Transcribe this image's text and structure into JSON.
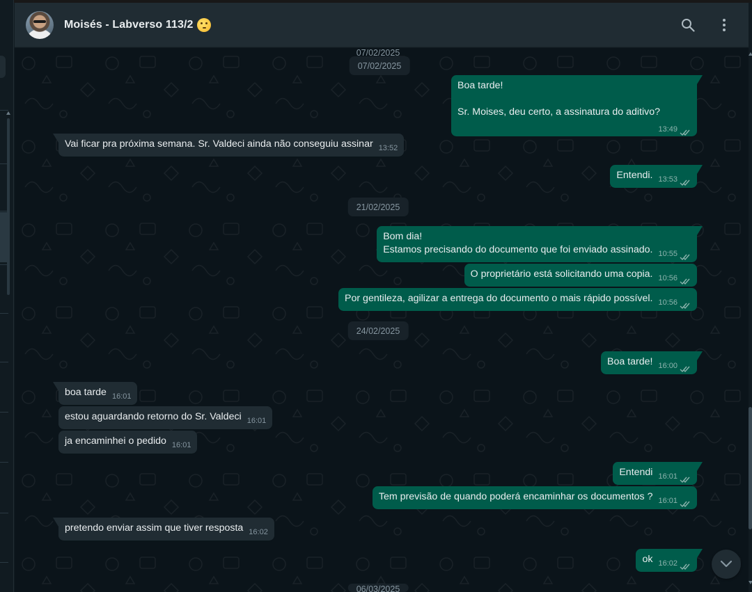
{
  "header": {
    "contact_name": "Moisés - Labverso 113/2",
    "avatar": "contact-photo",
    "emoji": "shushing-face-emoji",
    "actions": [
      "search-icon",
      "menu-dots-icon"
    ]
  },
  "colors": {
    "outgoing_bubble": "#005c4b",
    "incoming_bubble": "#202c33",
    "chat_background": "#0b141a",
    "header_background": "#202c33",
    "text_primary": "#e9edef",
    "text_secondary": "#8696a0"
  },
  "chat": {
    "top_partial_date": "07/02/2025",
    "bottom_partial_date": "06/03/2025",
    "dates": [
      "07/02/2025",
      "21/02/2025",
      "24/02/2025"
    ],
    "messages": [
      {
        "dir": "out",
        "text": "Boa tarde!\n\nSr. Moises, deu certo, a assinatura do aditivo?",
        "time": "13:49",
        "read": true
      },
      {
        "dir": "in",
        "text": "Vai ficar pra próxima semana. Sr. Valdeci ainda não conseguiu assinar",
        "time": "13:52"
      },
      {
        "dir": "out",
        "text": "Entendi.",
        "time": "13:53",
        "read": true
      },
      {
        "dir": "out",
        "text": "Bom dia!\nEstamos precisando do documento que foi enviado assinado.",
        "time": "10:55",
        "read": true
      },
      {
        "dir": "out",
        "text": "O proprietário está solicitando uma copia.",
        "time": "10:56",
        "read": true
      },
      {
        "dir": "out",
        "text": "Por gentileza, agilizar a entrega do documento o mais rápido possível.",
        "time": "10:56",
        "read": true
      },
      {
        "dir": "out",
        "text": "Boa tarde!",
        "time": "16:00",
        "read": true
      },
      {
        "dir": "in",
        "text": "boa tarde",
        "time": "16:01"
      },
      {
        "dir": "in",
        "text": "estou aguardando retorno do Sr. Valdeci",
        "time": "16:01"
      },
      {
        "dir": "in",
        "text": "ja encaminhei o pedido",
        "time": "16:01"
      },
      {
        "dir": "out",
        "text": "Entendi",
        "time": "16:01",
        "read": true
      },
      {
        "dir": "out",
        "text": "Tem previsão de quando poderá encaminhar os documentos ?",
        "time": "16:01",
        "read": true
      },
      {
        "dir": "in",
        "text": "pretendo enviar assim que tiver resposta",
        "time": "16:02"
      },
      {
        "dir": "out",
        "text": "ok",
        "time": "16:02",
        "read": true
      }
    ]
  },
  "scroll_button": "chevron-down-icon"
}
